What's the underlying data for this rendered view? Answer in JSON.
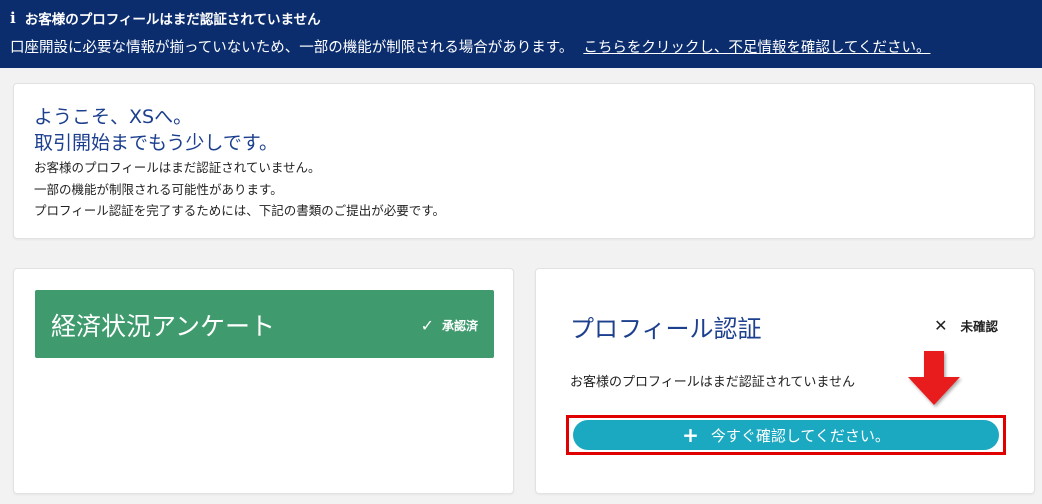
{
  "banner": {
    "title": "お客様のプロフィールはまだ認証されていません",
    "message": "口座開設に必要な情報が揃っていないため、一部の機能が制限される場合があります。",
    "link": "こちらをクリックし、不足情報を確認してください。",
    "icon": "info-icon"
  },
  "welcome": {
    "heading_line1": "ようこそ、XSへ。",
    "heading_line2": "取引開始までもう少しです。",
    "text_line1": "お客様のプロフィールはまだ認証されていません。",
    "text_line2": "一部の機能が制限される可能性があります。",
    "text_line3": "プロフィール認証を完了するためには、下記の書類のご提出が必要です。"
  },
  "survey": {
    "title": "経済状況アンケート",
    "status": "承認済",
    "status_icon": "check-icon",
    "color": "#3f9b6e"
  },
  "profile": {
    "title": "プロフィール認証",
    "status": "未確認",
    "status_icon": "x-icon",
    "message": "お客様のプロフィールはまだ認証されていません",
    "button_label": "今すぐ確認してください。",
    "button_icon": "plus-icon",
    "button_color": "#1aa9c1",
    "highlight_color": "#e00000"
  },
  "colors": {
    "banner_bg": "#0b2d6e",
    "heading_blue": "#1c3f8e"
  }
}
